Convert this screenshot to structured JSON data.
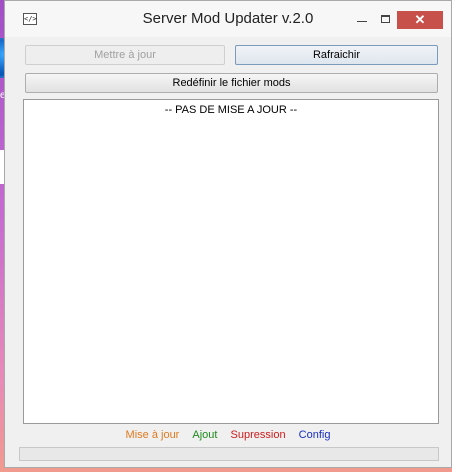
{
  "window": {
    "title": "Server Mod Updater  v.2.0",
    "icon_text": "</>"
  },
  "desktop": {
    "partial_label": "es"
  },
  "buttons": {
    "update": "Mettre à jour",
    "refresh": "Rafraichir",
    "redefine": "Redéfinir le fichier mods"
  },
  "log": {
    "text": "-- PAS DE MISE A JOUR --"
  },
  "footer": {
    "links": [
      {
        "label": "Mise à jour",
        "color": "#e07a1f"
      },
      {
        "label": "Ajout",
        "color": "#1e8a1e"
      },
      {
        "label": "Supression",
        "color": "#cc1c1c"
      },
      {
        "label": "Config",
        "color": "#1a2fbf"
      }
    ]
  },
  "colors": {
    "close_button": "#c7504a"
  }
}
